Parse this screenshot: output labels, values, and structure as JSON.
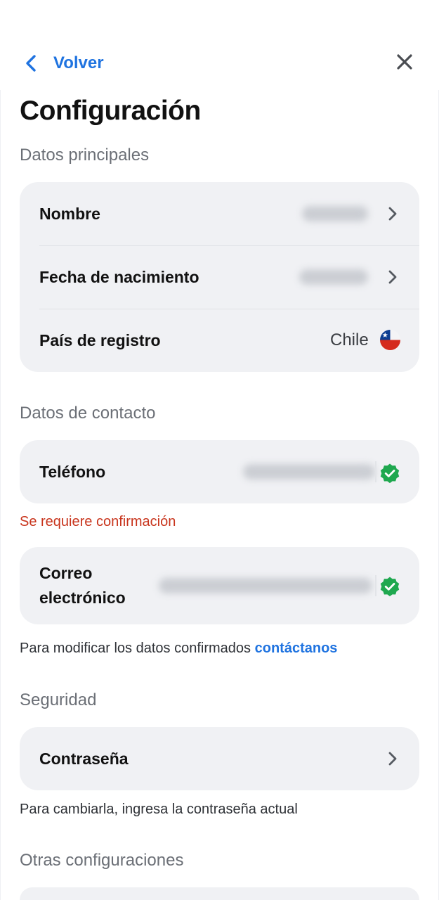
{
  "nav": {
    "back_label": "Volver"
  },
  "title": "Configuración",
  "sections": {
    "main": "Datos principales",
    "contact": "Datos de contacto",
    "security": "Seguridad",
    "other": "Otras configuraciones"
  },
  "main_rows": {
    "name_label": "Nombre",
    "birthdate_label": "Fecha de nacimiento",
    "country_label": "País de registro",
    "country_value": "Chile"
  },
  "contact": {
    "phone_label": "Teléfono",
    "phone_warning": "Se requiere confirmación",
    "email_label_line1": "Correo",
    "email_label_line2": "electrónico",
    "note_text": "Para modificar los datos confirmados",
    "note_link": "contáctanos"
  },
  "security": {
    "password_label": "Contraseña",
    "password_note": "Para cambiarla, ingresa la contraseña actual"
  },
  "colors": {
    "accent": "#1f73e0",
    "error": "#c8341c",
    "verified": "#1fa84f",
    "card": "#f0f1f4"
  },
  "icons": {
    "back": "chevron-left-icon",
    "close": "close-icon",
    "row_chevron": "chevron-right-icon",
    "verified": "verified-badge-icon",
    "flag": "chile-flag-icon"
  }
}
